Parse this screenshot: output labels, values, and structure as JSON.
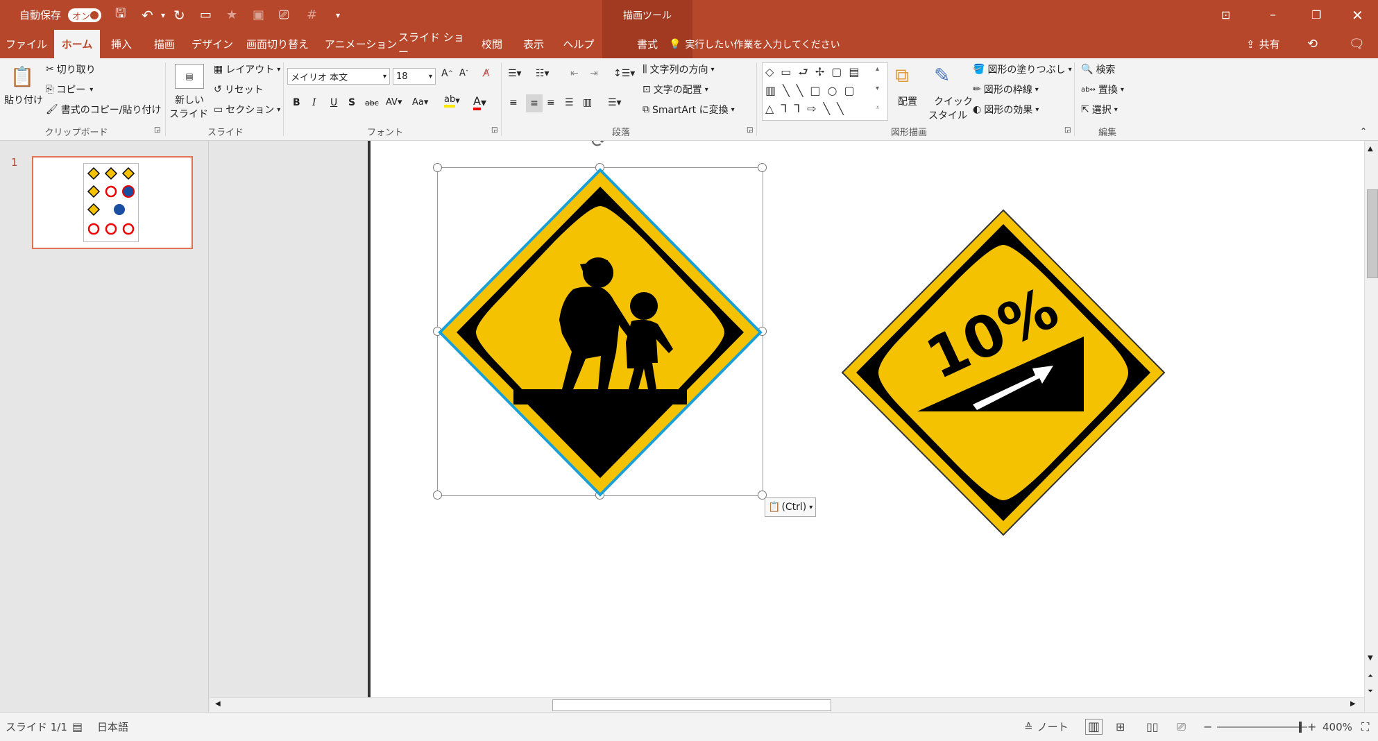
{
  "titlebar": {
    "autosave_label": "自動保存",
    "autosave_toggle": "オン",
    "tool_context": "描画ツール",
    "search_placeholder": "実行したい作業を入力してください",
    "share_label": "共有"
  },
  "tabs": [
    "ファイル",
    "ホーム",
    "挿入",
    "描画",
    "デザイン",
    "画面切り替え",
    "アニメーション",
    "スライド ショー",
    "校閲",
    "表示",
    "ヘルプ",
    "書式"
  ],
  "ribbon": {
    "clipboard": {
      "paste": "貼り付け",
      "cut": "切り取り",
      "copy": "コピー",
      "format_painter": "書式のコピー/貼り付け",
      "group": "クリップボード"
    },
    "slides": {
      "new_slide_line1": "新しい",
      "new_slide_line2": "スライド",
      "layout": "レイアウト",
      "reset": "リセット",
      "section": "セクション",
      "group": "スライド"
    },
    "font": {
      "font_name": "メイリオ 本文",
      "font_size": "18",
      "group": "フォント"
    },
    "paragraph": {
      "text_direction": "文字列の方向",
      "align_text": "文字の配置",
      "smartart": "SmartArt に変換",
      "group": "段落"
    },
    "drawing": {
      "arrange": "配置",
      "quick_styles_line1": "クイック",
      "quick_styles_line2": "スタイル",
      "shape_fill": "図形の塗りつぶし",
      "shape_outline": "図形の枠線",
      "shape_effects": "図形の効果",
      "group": "図形描画"
    },
    "editing": {
      "find": "検索",
      "replace": "置換",
      "select": "選択",
      "group": "編集"
    }
  },
  "thumbnail": {
    "number": "1"
  },
  "slide": {
    "sign2_text": "10%",
    "paste_options": "(Ctrl)"
  },
  "statusbar": {
    "slide_info": "スライド 1/1",
    "language": "日本語",
    "notes": "ノート",
    "zoom": "400%"
  }
}
